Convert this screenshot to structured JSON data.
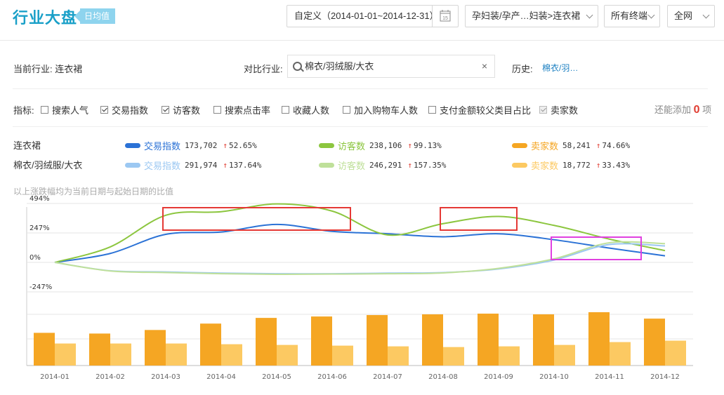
{
  "header": {
    "title": "行业大盘",
    "badge": "日均值",
    "date_range": "自定义（2014-01-01~2014-12-31）",
    "calendar_day": "15",
    "category": "孕妇装/孕产…妇装>连衣裙",
    "terminal": "所有终端",
    "network": "全网"
  },
  "filters": {
    "current_label": "当前行业:",
    "current_value": "连衣裙",
    "compare_label": "对比行业:",
    "compare_value": "棉衣/羽绒服/大衣",
    "clear": "×",
    "history_label": "历史:",
    "history_value": "棉衣/羽…"
  },
  "indicators": {
    "label": "指标:",
    "items": [
      {
        "label": "搜索人气",
        "checked": false
      },
      {
        "label": "交易指数",
        "checked": true
      },
      {
        "label": "访客数",
        "checked": true
      },
      {
        "label": "搜索点击率",
        "checked": false
      },
      {
        "label": "收藏人数",
        "checked": false
      },
      {
        "label": "加入购物车人数",
        "checked": false
      },
      {
        "label": "支付金额较父类目占比",
        "checked": false
      },
      {
        "label": "卖家数",
        "checked": true,
        "disabled": true
      }
    ],
    "remain_prefix": "还能添加",
    "remain_count": "0",
    "remain_suffix": "项"
  },
  "legend": {
    "rows": [
      {
        "industry": "连衣裙",
        "items": [
          {
            "name": "交易指数",
            "value": "173,702",
            "change": "52.65%",
            "color": "#2b72d6"
          },
          {
            "name": "访客数",
            "value": "238,106",
            "change": "99.13%",
            "color": "#8cc63f"
          },
          {
            "name": "卖家数",
            "value": "58,241",
            "change": "74.66%",
            "color": "#f5a623"
          }
        ]
      },
      {
        "industry": "棉衣/羽绒服/大衣",
        "items": [
          {
            "name": "交易指数",
            "value": "291,974",
            "change": "137.64%",
            "color": "#9cc8f2"
          },
          {
            "name": "访客数",
            "value": "246,291",
            "change": "157.35%",
            "color": "#bfe09a"
          },
          {
            "name": "卖家数",
            "value": "18,772",
            "change": "33.43%",
            "color": "#fcc962"
          }
        ]
      }
    ],
    "note": "以上涨跌幅均为当前日期与起始日期的比值"
  },
  "chart_data": {
    "type": "line",
    "x": [
      "2014-01",
      "2014-02",
      "2014-03",
      "2014-04",
      "2014-05",
      "2014-06",
      "2014-07",
      "2014-08",
      "2014-09",
      "2014-10",
      "2014-11",
      "2014-12"
    ],
    "y_ticks": [
      "494%",
      "247%",
      "0%",
      "-247%"
    ],
    "line_ylim": [
      -247,
      494
    ],
    "series": [
      {
        "name": "交易指数",
        "industry": "连衣裙",
        "color": "#2b72d6",
        "values": [
          0,
          75,
          235,
          255,
          318,
          260,
          240,
          215,
          240,
          190,
          120,
          55
        ]
      },
      {
        "name": "访客数",
        "industry": "连衣裙",
        "color": "#8cc63f",
        "values": [
          0,
          130,
          395,
          425,
          490,
          430,
          230,
          325,
          385,
          310,
          195,
          99
        ]
      },
      {
        "name": "交易指数",
        "industry": "棉衣/羽绒服/大衣",
        "color": "#9cc8f2",
        "values": [
          0,
          -70,
          -80,
          -90,
          -95,
          -95,
          -90,
          -85,
          -55,
          20,
          150,
          138
        ]
      },
      {
        "name": "访客数",
        "industry": "棉衣/羽绒服/大衣",
        "color": "#bfe09a",
        "values": [
          0,
          -72,
          -85,
          -95,
          -100,
          -98,
          -95,
          -88,
          -50,
          30,
          165,
          157
        ]
      }
    ],
    "bars": [
      {
        "name": "卖家数",
        "industry": "连衣裙",
        "color": "#f5a623",
        "values": [
          46,
          45,
          50,
          59,
          67,
          69,
          71,
          72,
          73,
          72,
          75,
          66
        ]
      },
      {
        "name": "卖家数",
        "industry": "棉衣/羽绒服/大衣",
        "color": "#fcc962",
        "values": [
          31,
          31,
          31,
          30,
          29,
          28,
          27,
          26,
          27,
          29,
          33,
          35
        ]
      },
      {
        "name": "",
        "industry": "",
        "color": "",
        "values": []
      }
    ],
    "bar_ylim": [
      0,
      100
    ],
    "highlight_boxes": [
      {
        "color": "#e53935",
        "x_from": "2014-03",
        "x_to": "2014-06",
        "y_from": 247,
        "y_to": 494
      },
      {
        "color": "#e53935",
        "x_from": "2014-08",
        "x_to": "2014-09",
        "y_from": 247,
        "y_to": 494
      },
      {
        "color": "#e040e0",
        "x_from": "2014-10",
        "x_to": "2014-12",
        "y_from": 0,
        "y_to": 247
      }
    ]
  }
}
